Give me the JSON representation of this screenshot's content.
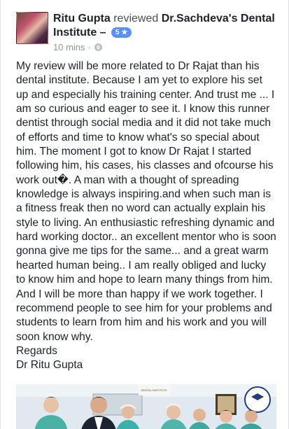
{
  "post": {
    "author": "Ritu Gupta",
    "verb": "reviewed",
    "page": "Dr.Sachdeva's Dental Institute",
    "dash": " –",
    "rating": "5 ★",
    "time": "10 mins",
    "dot": "·",
    "paragraph": "My review will be more related to Dr Rajat than his dental institute. Because I am yet to explore his set up and especially his training center. And trust me ... I am so curious and eager to see it. I know this runner dentist through social media and it did not take much of efforts and time to know what's so special about him. The moment I got to know Dr Rajat I started following him, his cases, his classes and ofcourse his work out�. A man with a thought of spreading knowledge is always inspiring.and when such man is a fitness freak then no word can actually explain his style to living. An enthusiastic refreshing dynamic and hard working doctor.. an excellent mentor who is soon gonna give me tips for the same... and a great warm hearted human being.. I am really obliged and lucky to know him and hope to learn many things from him. And I will be more than happy if we work together. I recommend people to see him for your problems and students to learn from him and his work and you will soon know why.",
    "regards": "Regards",
    "signature": "Dr Ritu Gupta"
  },
  "photo_strip": {
    "sign_text": "DENTAL INSTITUTE"
  },
  "colors": {
    "text": "#1d2129",
    "meta": "#90949c",
    "rating_badge": "#5890ff",
    "background": "#e9ebee"
  }
}
